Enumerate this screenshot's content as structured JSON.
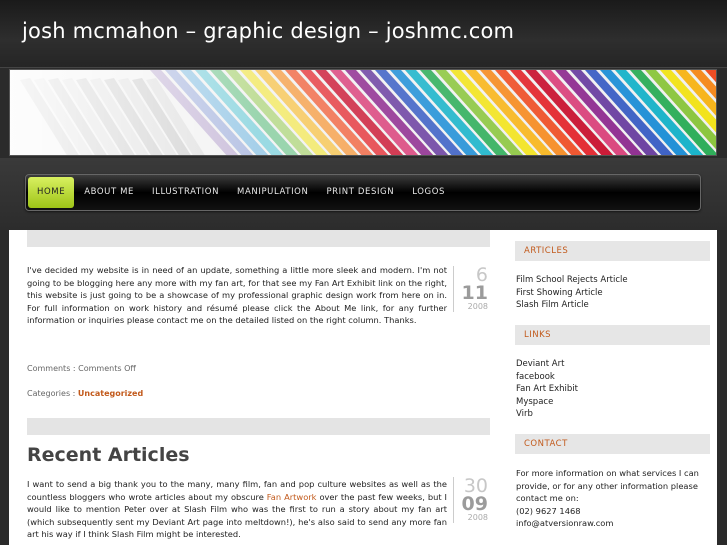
{
  "site": {
    "title": "josh mcmahon – graphic design – joshmc.com"
  },
  "nav": {
    "items": [
      "HOME",
      "ABOUT ME",
      "ILLUSTRATION",
      "MANIPULATION",
      "PRINT DESIGN",
      "LOGOS"
    ],
    "active": "HOME"
  },
  "post1": {
    "text": "I've decided my website is in need of an update, something a little more sleek and modern. I'm not going to be blogging here any more with my fan art, for that see my Fan Art Exhibit link on the right, this website is just going to be a showcase of my professional graphic design work from here on in. For full information on work history and résumé please click the About Me link, for any further information or inquiries please contact me on the detailed listed on the right column. Thanks.",
    "date": {
      "day": "6",
      "month": "11",
      "year": "2008"
    },
    "comments_label": "Comments : ",
    "comments_value": "Comments Off",
    "categories_label": "Categories : ",
    "category": "Uncategorized"
  },
  "post2": {
    "title": "Recent Articles",
    "text_before_link": "I want to send a big thank you to the many, many film, fan and pop culture websites as well as the countless bloggers who wrote articles about my obscure ",
    "link": "Fan Artwork",
    "text_after_link": " over the past few weeks, but I would like to mention Peter over at Slash Film who was the first to run a story about my fan art (which subsequently sent my Deviant Art page into meltdown!), he's also said to send any more fan art his way if I think Slash Film might be interested.",
    "date": {
      "day": "30",
      "month": "09",
      "year": "2008"
    }
  },
  "sidebar": {
    "articles": {
      "heading": "ARTICLES",
      "items": [
        "Film School Rejects Article",
        "First Showing Article",
        "Slash Film Article"
      ]
    },
    "links": {
      "heading": "LINKS",
      "items": [
        "Deviant Art",
        "facebook",
        "Fan Art Exhibit",
        "Myspace",
        "Virb"
      ]
    },
    "contact": {
      "heading": "CONTACT",
      "text": "For more information on what services I can provide, or for any other information please contact me on:",
      "phone": "(02) 9627 1468",
      "email": "info@atversionraw.com"
    }
  },
  "colors": {
    "accent": "#c25a1c",
    "nav_active": "#b5d42a",
    "background": "#2b2b2b"
  }
}
